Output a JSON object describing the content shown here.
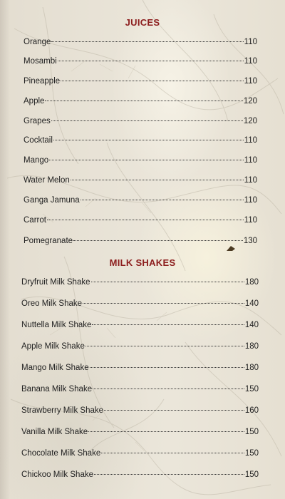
{
  "juices": {
    "title": "JUICES",
    "items": [
      {
        "name": "Orange",
        "price": "110"
      },
      {
        "name": "Mosambi",
        "price": "110"
      },
      {
        "name": "Pineapple",
        "price": "110"
      },
      {
        "name": "Apple",
        "price": "120"
      },
      {
        "name": "Grapes",
        "price": "120"
      },
      {
        "name": "Cocktail",
        "price": "110"
      },
      {
        "name": "Mango",
        "price": "110"
      },
      {
        "name": "Water Melon",
        "price": "110"
      },
      {
        "name": "Ganga Jamuna",
        "price": "110"
      },
      {
        "name": "Carrot",
        "price": "110"
      },
      {
        "name": "Pomegranate",
        "price": "130"
      }
    ]
  },
  "milk_shakes": {
    "title": "MILK SHAKES",
    "items": [
      {
        "name": "Dryfruit Milk Shake",
        "price": "180"
      },
      {
        "name": "Oreo Milk Shake",
        "price": "140"
      },
      {
        "name": "Nuttella Milk Shake",
        "price": "140"
      },
      {
        "name": "Apple Milk Shake",
        "price": "180"
      },
      {
        "name": "Mango Milk Shake",
        "price": "180"
      },
      {
        "name": "Banana Milk Shake",
        "price": "150"
      },
      {
        "name": "Strawberry Milk Shake",
        "price": "160"
      },
      {
        "name": "Vanilla Milk Shake",
        "price": "150"
      },
      {
        "name": "Chocolate Milk Shake",
        "price": "150"
      },
      {
        "name": "Chickoo Milk Shake",
        "price": "150"
      }
    ]
  },
  "colors": {
    "heading": "#8c1d1d",
    "text": "#222222",
    "paper": "#e9e3d5"
  }
}
